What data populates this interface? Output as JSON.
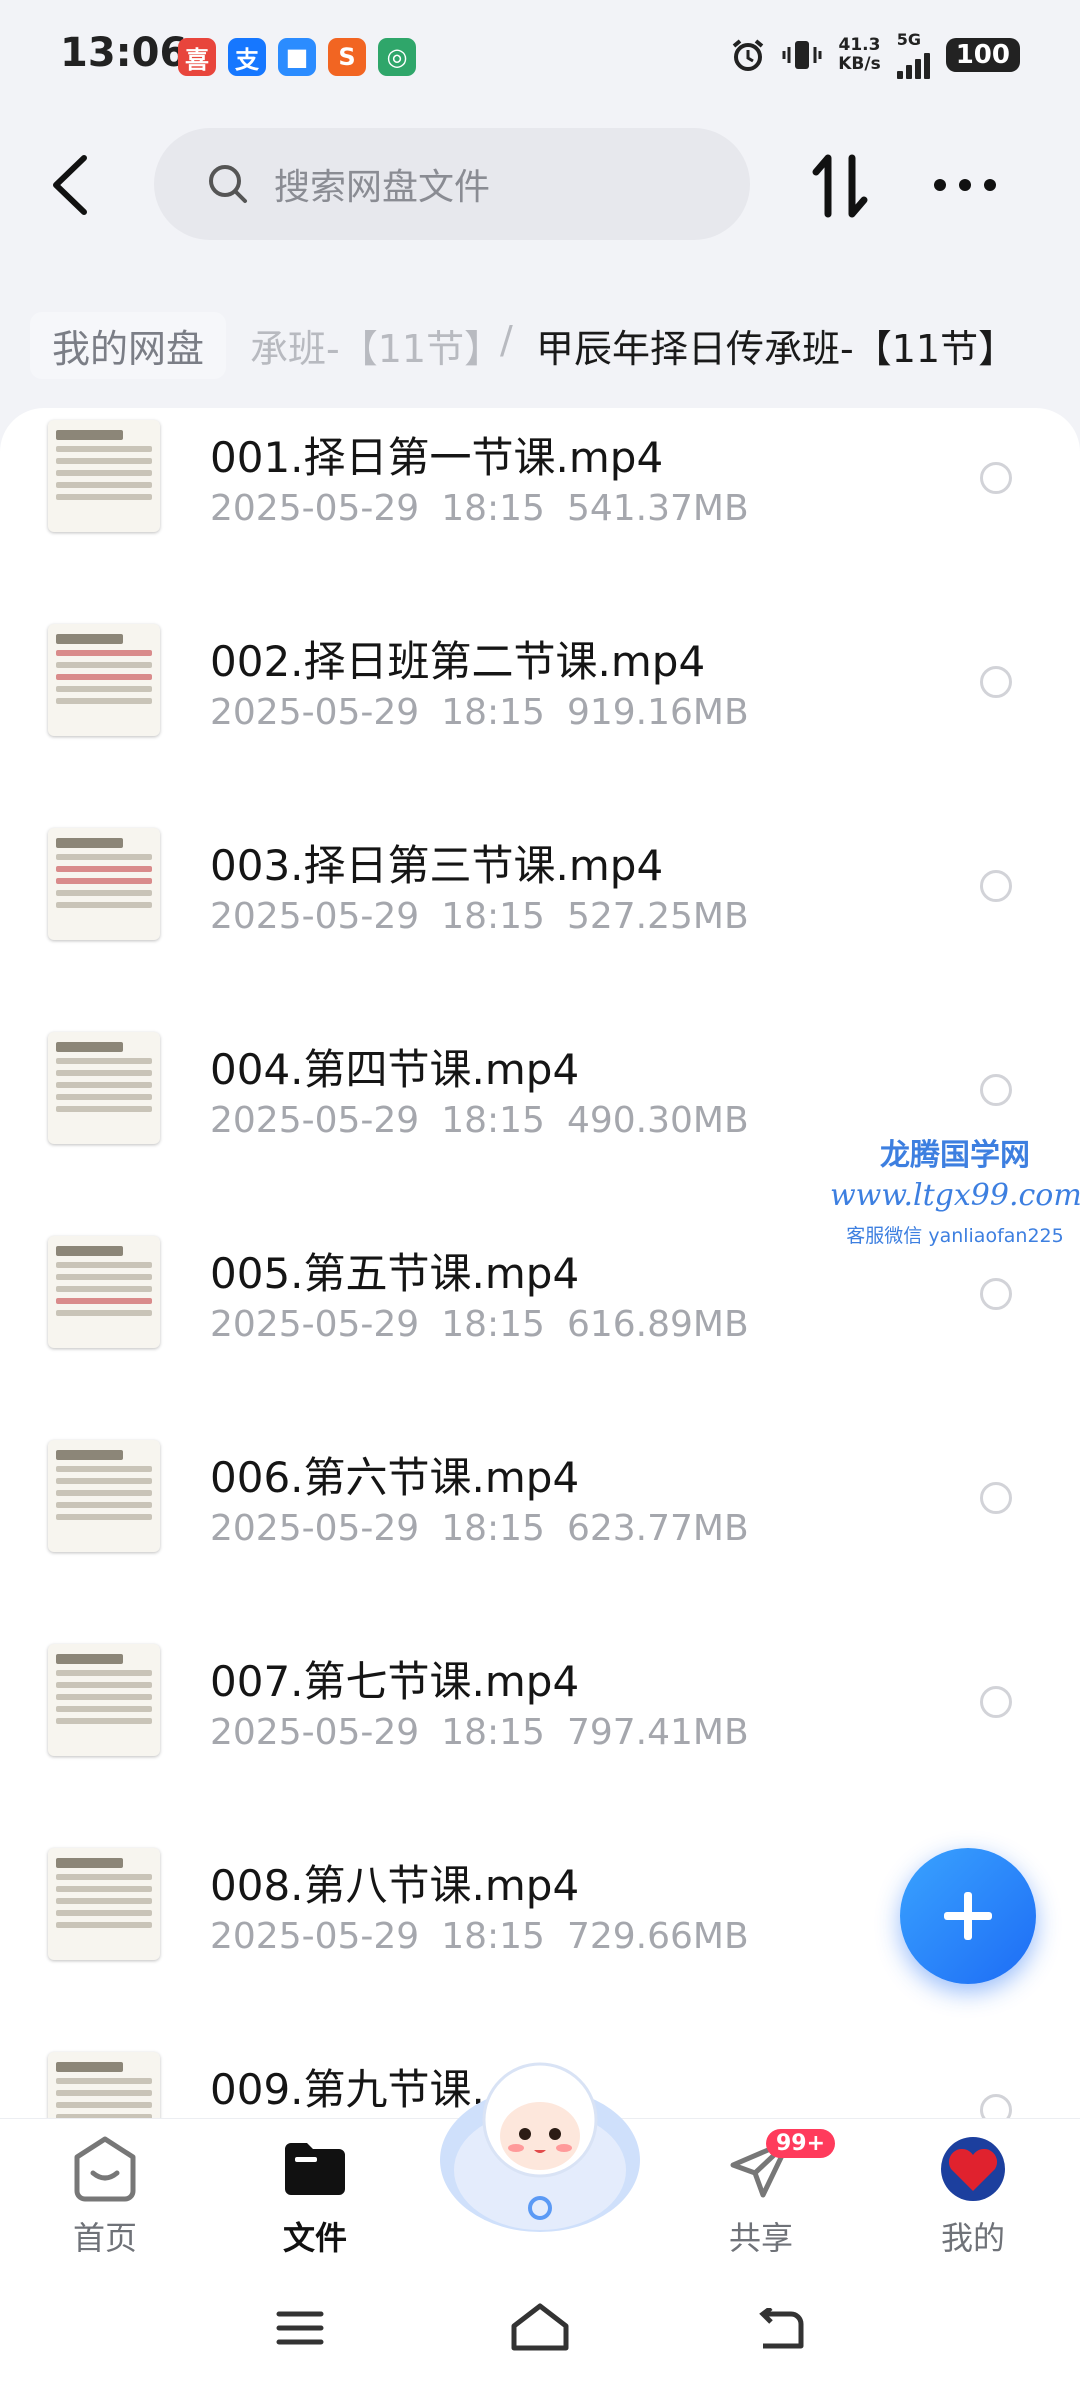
{
  "status_bar": {
    "time": "13:06",
    "net_speed": "41.3",
    "net_unit": "KB/s",
    "signal": "5G",
    "battery": "100",
    "app_icons": [
      {
        "name": "app-red-icon",
        "glyph": "喜",
        "color": "#e8453c"
      },
      {
        "name": "alipay-icon",
        "glyph": "支",
        "color": "#1677ff"
      },
      {
        "name": "app-blue-icon",
        "glyph": "■",
        "color": "#2b8cff"
      },
      {
        "name": "sogou-icon",
        "glyph": "S",
        "color": "#f26522"
      },
      {
        "name": "app-green-icon",
        "glyph": "◎",
        "color": "#2fa66a"
      }
    ]
  },
  "header": {
    "search_placeholder": "搜索网盘文件"
  },
  "breadcrumb": {
    "root": "我的网盘",
    "partial": "承班-【11节】",
    "separator": "/",
    "current": "甲辰年择日传承班-【11节】"
  },
  "files": [
    {
      "name": "001.择日第一节课.mp4",
      "date": "2025-05-29",
      "time": "18:15",
      "size": "541.37MB"
    },
    {
      "name": "002.择日班第二节课.mp4",
      "date": "2025-05-29",
      "time": "18:15",
      "size": "919.16MB"
    },
    {
      "name": "003.择日第三节课.mp4",
      "date": "2025-05-29",
      "time": "18:15",
      "size": "527.25MB"
    },
    {
      "name": "004.第四节课.mp4",
      "date": "2025-05-29",
      "time": "18:15",
      "size": "490.30MB"
    },
    {
      "name": "005.第五节课.mp4",
      "date": "2025-05-29",
      "time": "18:15",
      "size": "616.89MB"
    },
    {
      "name": "006.第六节课.mp4",
      "date": "2025-05-29",
      "time": "18:15",
      "size": "623.77MB"
    },
    {
      "name": "007.第七节课.mp4",
      "date": "2025-05-29",
      "time": "18:15",
      "size": "797.41MB"
    },
    {
      "name": "008.第八节课.mp4",
      "date": "2025-05-29",
      "time": "18:15",
      "size": "729.66MB"
    },
    {
      "name": "009.第九节课.",
      "date": "",
      "time": "",
      "size": ""
    }
  ],
  "watermark": {
    "line1": "龙腾国学网",
    "line2": "www.ltgx99.com",
    "line3": "客服微信 yanliaofan225"
  },
  "bottom_nav": {
    "home": "首页",
    "files": "文件",
    "share": "共享",
    "share_badge": "99+",
    "me": "我的"
  }
}
